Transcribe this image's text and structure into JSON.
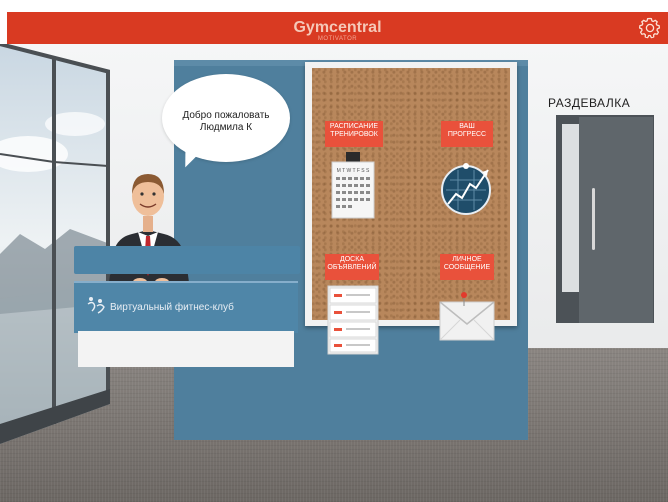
{
  "header": {
    "title": "Gymcentral",
    "subtitle": "MOTIVATOR",
    "settings_icon": "gear-icon"
  },
  "colors": {
    "header": "#d93a22",
    "tag": "#e9513b",
    "wall_panel": "#4f7f9d",
    "desk": "#4f86a8",
    "cork": "#b8875c"
  },
  "greeting": {
    "line1": "Добро пожаловать",
    "line2": "Людмила К"
  },
  "board": {
    "schedule": {
      "label": "РАСПИСАНИЕ ТРЕНИРОВОК",
      "icon": "calendar-icon",
      "calendar_header": "M T W T F S S"
    },
    "progress": {
      "label": "ВАШ ПРОГРЕСС",
      "icon": "progress-chart-icon"
    },
    "announcements": {
      "label": "ДОСКА ОБЪЯВЛЕНИЙ",
      "icon": "file-cabinet-icon"
    },
    "messages": {
      "label": "ЛИЧНОЕ СООБЩЕНИЕ",
      "icon": "envelope-icon"
    }
  },
  "desk": {
    "text": "Виртуальный фитнес-клуб",
    "logo_icon": "fitness-logo-icon"
  },
  "door": {
    "label": "РАЗДЕВАЛКА"
  }
}
